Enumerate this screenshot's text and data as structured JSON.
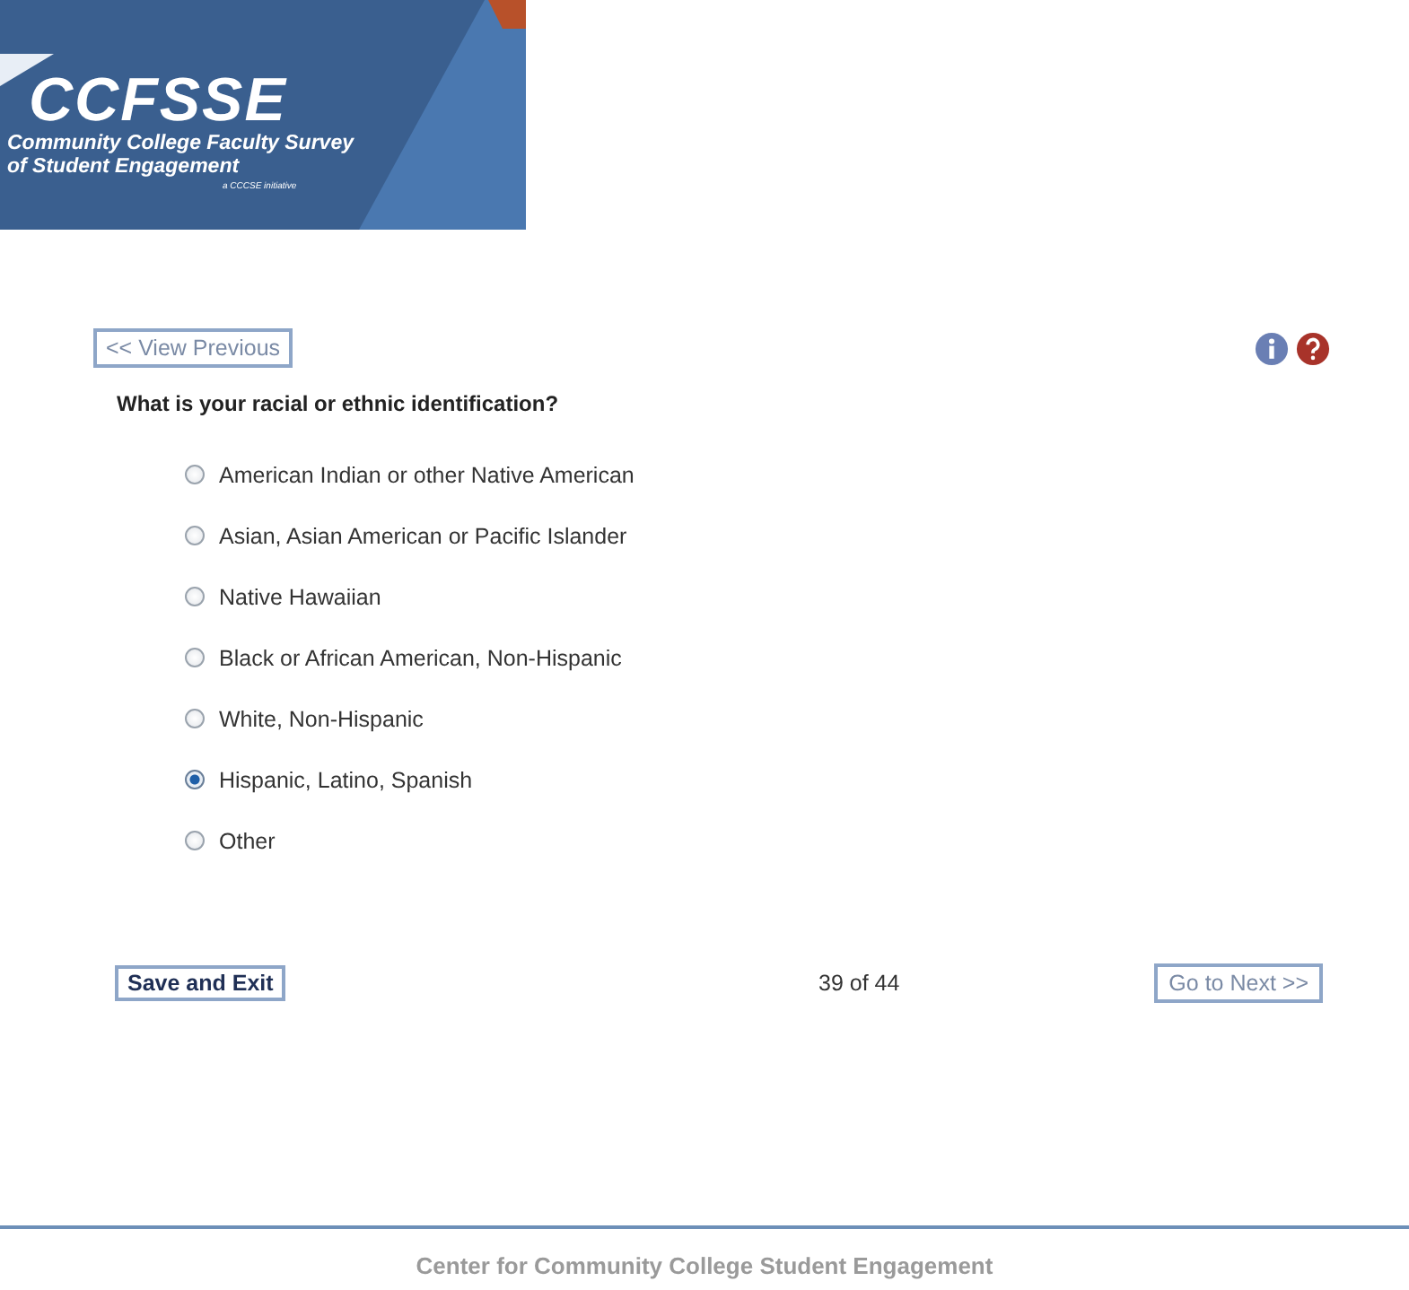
{
  "logo": {
    "title": "CCFSSE",
    "subtitle_1": "Community College Faculty Survey",
    "subtitle_2": "of Student Engagement",
    "tagline": "a CCCSE initiative"
  },
  "nav": {
    "previous": "<< View Previous"
  },
  "question": "What is your racial or ethnic identification?",
  "options": [
    {
      "label": "American Indian or other Native American",
      "selected": false
    },
    {
      "label": "Asian, Asian American or Pacific Islander",
      "selected": false
    },
    {
      "label": "Native Hawaiian",
      "selected": false
    },
    {
      "label": "Black or African American, Non-Hispanic",
      "selected": false
    },
    {
      "label": "White, Non-Hispanic",
      "selected": false
    },
    {
      "label": "Hispanic, Latino, Spanish",
      "selected": true
    },
    {
      "label": "Other",
      "selected": false
    }
  ],
  "footer_nav": {
    "save": "Save and Exit",
    "progress": "39 of 44",
    "next": "Go to Next >>"
  },
  "footer": {
    "org": "Center for Community College Student Engagement"
  }
}
